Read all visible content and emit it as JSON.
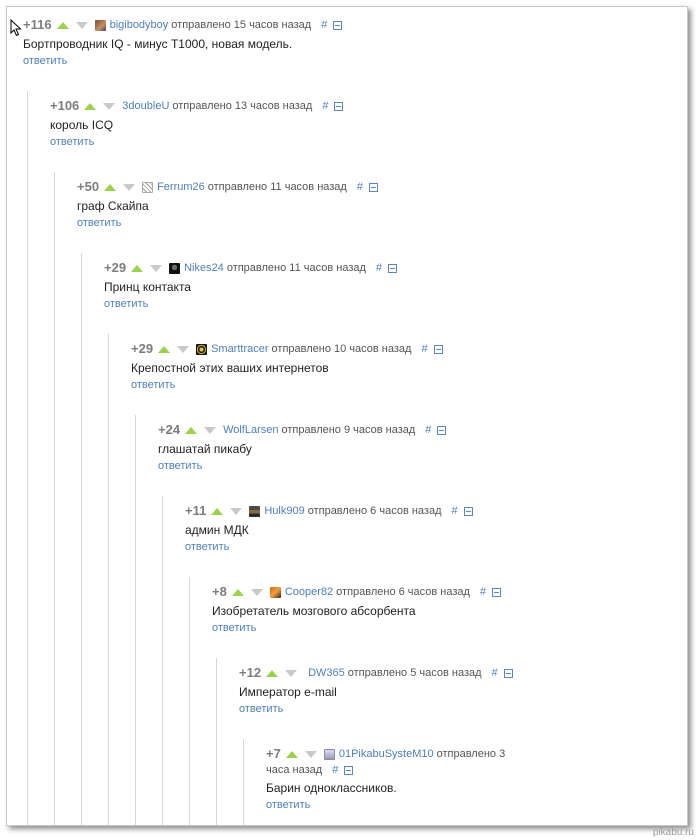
{
  "watermark": "pikabu.ru",
  "labels": {
    "reply": "ответить",
    "hash": "#"
  },
  "colors": {
    "link": "#4d7fbc",
    "upvote": "#9ad34a",
    "downvote": "#c9c9c9"
  },
  "comments": [
    {
      "rating": "+116",
      "user": "bigibodyboy",
      "time": "отправлено 15 часов назад",
      "text": "Бортпроводник IQ - минус Т1000, новая модель.",
      "avatar": "user-avatar"
    },
    {
      "rating": "+106",
      "user": "3doubleU",
      "time": "отправлено 13 часов назад",
      "text": "король ICQ",
      "avatar": "none"
    },
    {
      "rating": "+50",
      "user": "Ferrum26",
      "time": "отправлено 11 часов назад",
      "text": "граф Скайпа",
      "avatar": "user-avatar"
    },
    {
      "rating": "+29",
      "user": "Nikes24",
      "time": "отправлено 11 часов назад",
      "text": "Принц контакта",
      "avatar": "user-avatar"
    },
    {
      "rating": "+29",
      "user": "Smarttracer",
      "time": "отправлено 10 часов назад",
      "text": "Крепостной этих ваших интернетов",
      "avatar": "user-avatar"
    },
    {
      "rating": "+24",
      "user": "WolfLarsen",
      "time": "отправлено 9 часов назад",
      "text": "глашатай пикабу",
      "avatar": "none"
    },
    {
      "rating": "+11",
      "user": "Hulk909",
      "time": "отправлено 6 часов назад",
      "text": "админ МДК",
      "avatar": "user-avatar"
    },
    {
      "rating": "+8",
      "user": "Cooper82",
      "time": "отправлено 6 часов назад",
      "text": "Изобретатель мозгового абсорбента",
      "avatar": "user-avatar"
    },
    {
      "rating": "+12",
      "user": "DW365",
      "time": "отправлено 5 часов назад",
      "text": "Император e-mail",
      "avatar": "none"
    },
    {
      "rating": "+7",
      "user": "01PikabuSysteM10",
      "time_line1": "отправлено 3",
      "time_line2": "часа назад",
      "text": "Барин одноклассников.",
      "avatar": "user-avatar"
    }
  ]
}
